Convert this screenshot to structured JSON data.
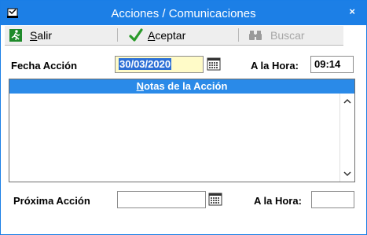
{
  "window": {
    "title": "Acciones / Comunicaciones",
    "close_glyph": "×"
  },
  "toolbar": {
    "salir": {
      "prefix": "",
      "accel": "S",
      "rest": "alir",
      "icon": "exit-icon"
    },
    "aceptar": {
      "prefix": "",
      "accel": "A",
      "rest": "ceptar",
      "icon": "checkmark-icon"
    },
    "buscar": {
      "label": "Buscar",
      "icon": "binoculars-icon"
    }
  },
  "form": {
    "fecha_label": "Fecha Acción",
    "fecha_value": "30/03/2020",
    "hora_label": "A la Hora:",
    "hora_value": "09:14",
    "notas_header_accel": "N",
    "notas_header_rest": "otas de la Acción",
    "notas_value": "",
    "proxima_label": "Próxima Acción",
    "proxima_value": "",
    "hora2_label": "A la Hora:",
    "hora2_value": ""
  },
  "colors": {
    "titlebar": "#1c7fe6",
    "notes_header": "#2a8ae8",
    "selection": "#2c6fd6"
  }
}
